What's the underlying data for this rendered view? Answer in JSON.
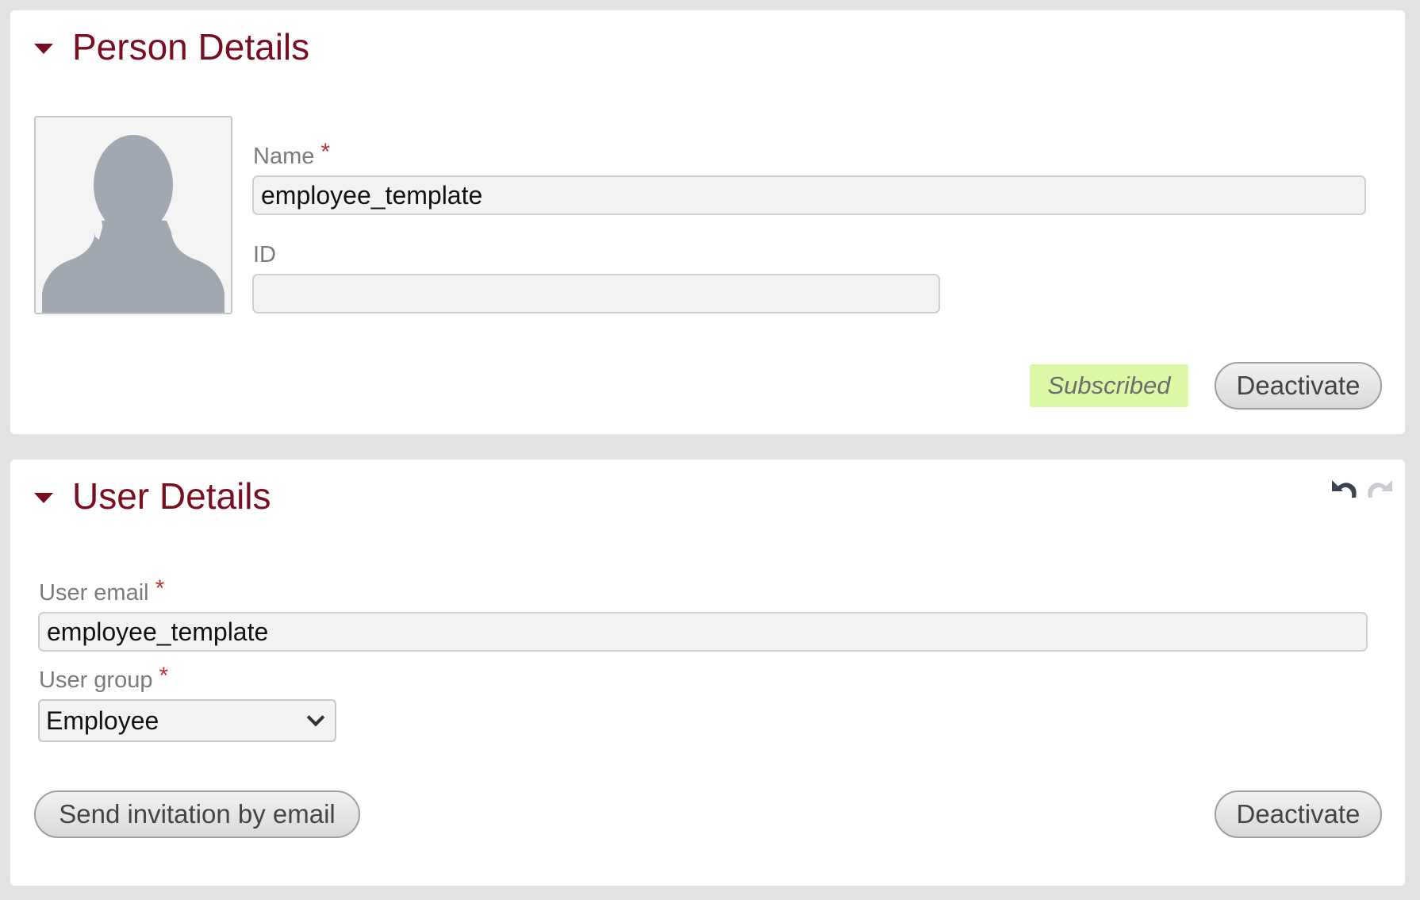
{
  "person_details": {
    "title": "Person Details",
    "name_label": "Name",
    "name_required_mark": "*",
    "name_value": "employee_template",
    "id_label": "ID",
    "id_value": "",
    "status_badge": "Subscribed",
    "deactivate_label": "Deactivate"
  },
  "user_details": {
    "title": "User Details",
    "email_label": "User email",
    "email_required_mark": "*",
    "email_value": "employee_template",
    "group_label": "User group",
    "group_required_mark": "*",
    "group_value": "Employee",
    "send_invite_label": "Send invitation by email",
    "deactivate_label": "Deactivate",
    "icons": {
      "undo": "undo-icon",
      "redo": "redo-icon"
    }
  },
  "colors": {
    "title": "#7a0d1f",
    "required": "#b8353d",
    "subscribed_bg": "#daf8a6",
    "page_bg": "#e3e3e3",
    "avatar_silhouette": "#a1a8b1"
  }
}
